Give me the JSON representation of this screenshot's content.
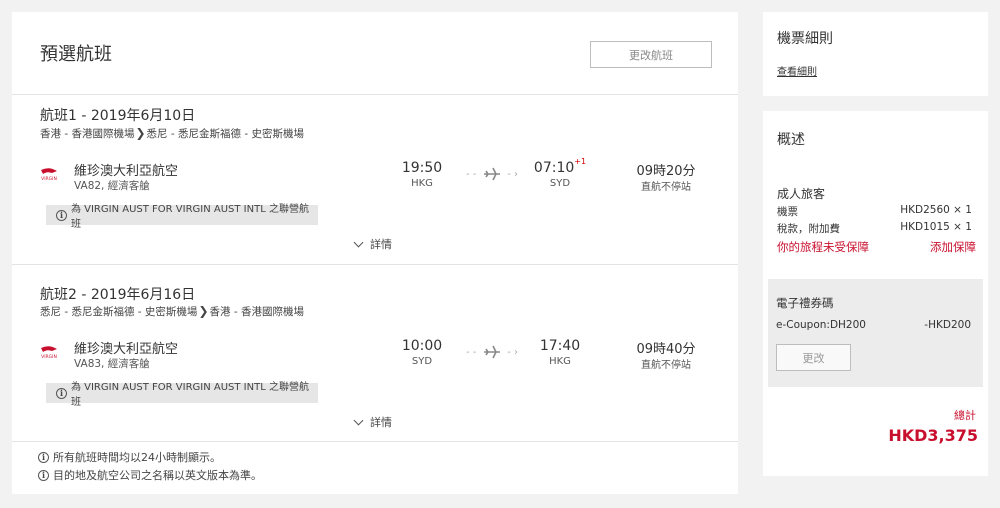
{
  "main": {
    "title": "預選航班",
    "change_flight_label": "更改航班",
    "legs": [
      {
        "title": "航班1 - 2019年6月10日",
        "route_from": "香港 - 香港國際機場",
        "route_to": "悉尼 - 悉尼金斯福德 - 史密斯機場",
        "airline": "維珍澳大利亞航空",
        "flight_info": "VA82, 經濟客艙",
        "depart_time": "19:50",
        "depart_code": "HKG",
        "arrive_time": "07:10",
        "arrive_day_offset": "+1",
        "arrive_code": "SYD",
        "duration": "09時20分",
        "stops": "直航不停站",
        "codeshare": "為 VIRGIN AUST FOR VIRGIN AUST INTL 之聯營航班",
        "details_label": "詳情"
      },
      {
        "title": "航班2 - 2019年6月16日",
        "route_from": "悉尼 - 悉尼金斯福德 - 史密斯機場",
        "route_to": "香港 - 香港國際機場",
        "airline": "維珍澳大利亞航空",
        "flight_info": "VA83, 經濟客艙",
        "depart_time": "10:00",
        "depart_code": "SYD",
        "arrive_time": "17:40",
        "arrive_day_offset": "",
        "arrive_code": "HKG",
        "duration": "09時40分",
        "stops": "直航不停站",
        "codeshare": "為 VIRGIN AUST FOR VIRGIN AUST INTL 之聯營航班",
        "details_label": "詳情"
      }
    ],
    "notes": [
      "所有航班時間均以24小時制顯示。",
      "目的地及航空公司之名稱以英文版本為準。"
    ],
    "logo_text": "VIRGIN"
  },
  "fare_rules": {
    "title": "機票細則",
    "link": "查看細則"
  },
  "summary": {
    "title": "概述",
    "passenger_type": "成人旅客",
    "ticket_label": "機票",
    "ticket_value": "HKD2560 × 1",
    "tax_label": "稅款，附加費",
    "tax_value": "HKD1015 × 1",
    "insurance_warning": "你的旅程未受保障",
    "add_insurance": "添加保障",
    "coupon_title": "電子禮券碼",
    "coupon_name": "e-Coupon:DH200",
    "coupon_value": "-HKD200",
    "coupon_change": "更改",
    "total_label": "總計",
    "total_value": "HKD3,375"
  },
  "colors": {
    "accent_red": "#c8102e",
    "background": "#f2f2f2"
  }
}
